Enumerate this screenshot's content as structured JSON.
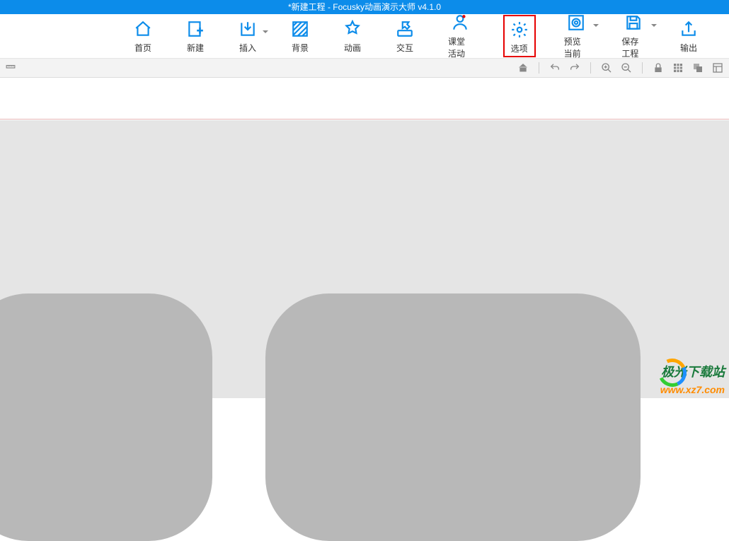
{
  "title": "*新建工程 - Focusky动画演示大师  v4.1.0",
  "toolbar": [
    {
      "id": "home",
      "label": "首页",
      "caret": false,
      "highlight": false
    },
    {
      "id": "new",
      "label": "新建",
      "caret": false,
      "highlight": false
    },
    {
      "id": "insert",
      "label": "插入",
      "caret": true,
      "highlight": false
    },
    {
      "id": "background",
      "label": "背景",
      "caret": false,
      "highlight": false
    },
    {
      "id": "animation",
      "label": "动画",
      "caret": false,
      "highlight": false
    },
    {
      "id": "interaction",
      "label": "交互",
      "caret": false,
      "highlight": false
    },
    {
      "id": "class",
      "label": "课堂活动",
      "caret": false,
      "highlight": false
    },
    {
      "id": "options",
      "label": "选项",
      "caret": false,
      "highlight": true
    },
    {
      "id": "preview",
      "label": "预览当前",
      "caret": true,
      "highlight": false
    },
    {
      "id": "save",
      "label": "保存工程",
      "caret": true,
      "highlight": false
    },
    {
      "id": "export",
      "label": "输出",
      "caret": false,
      "highlight": false
    }
  ],
  "subtoolbar": {
    "left": [
      {
        "id": "ruler"
      }
    ],
    "right": [
      {
        "id": "home-small"
      },
      {
        "id": "divider"
      },
      {
        "id": "undo"
      },
      {
        "id": "redo"
      },
      {
        "id": "divider"
      },
      {
        "id": "zoom-in"
      },
      {
        "id": "zoom-out"
      },
      {
        "id": "divider"
      },
      {
        "id": "lock"
      },
      {
        "id": "grid"
      },
      {
        "id": "layers"
      },
      {
        "id": "panel"
      }
    ]
  },
  "watermark": {
    "title": "极光下载站",
    "url": "www.xz7.com"
  }
}
